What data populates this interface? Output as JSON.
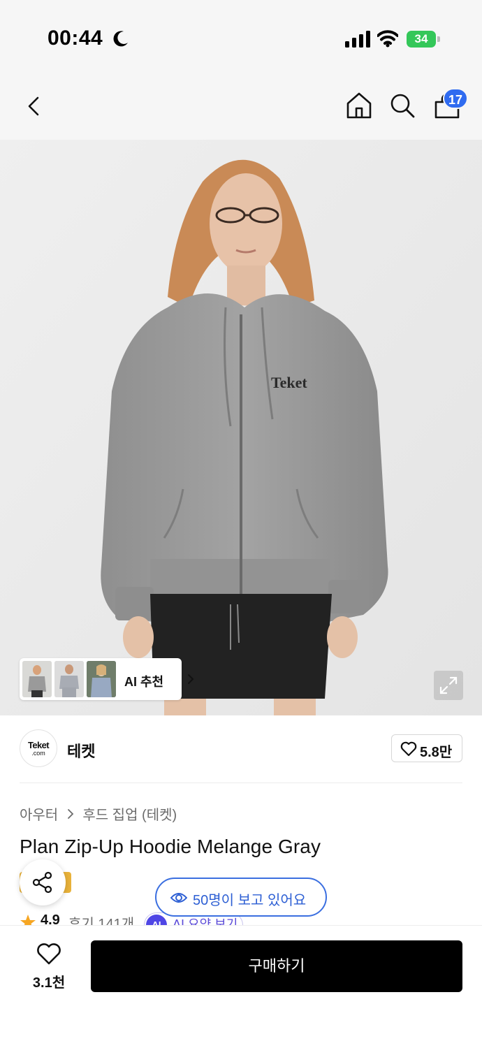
{
  "status_bar": {
    "time": "00:44",
    "battery": "34"
  },
  "nav": {
    "cart_count": "17"
  },
  "gallery": {
    "recommend_label": "AI 추천",
    "logo_on_hoodie": "Teket"
  },
  "brand": {
    "logo_text": "Teket",
    "logo_sub": ".com",
    "name": "테켓",
    "like_count": "5.8만"
  },
  "breadcrumb": {
    "category": "아우터",
    "subcategory": "후드 집업 (테켓)"
  },
  "product": {
    "title": "Plan Zip-Up Hoodie Melange Gray"
  },
  "rating": {
    "value": "4.9",
    "reviews": "후기 141개",
    "ai_badge": "AI",
    "ai_summary": "AI 요약 보기"
  },
  "viewers": {
    "text": "50명이 보고 있어요"
  },
  "bottom": {
    "wish_count": "3.1천",
    "buy_label": "구매하기"
  },
  "colors": {
    "accent_blue": "#2f6bf0",
    "battery_green": "#34c759",
    "buy_button": "#000000",
    "ai_purple": "#4f46e5"
  },
  "icons": [
    "moon-icon",
    "signal-icon",
    "wifi-icon",
    "back-arrow-icon",
    "home-icon",
    "search-icon",
    "bag-icon",
    "chevron-right-icon",
    "expand-icon",
    "heart-icon",
    "share-icon",
    "star-icon",
    "eye-icon"
  ]
}
